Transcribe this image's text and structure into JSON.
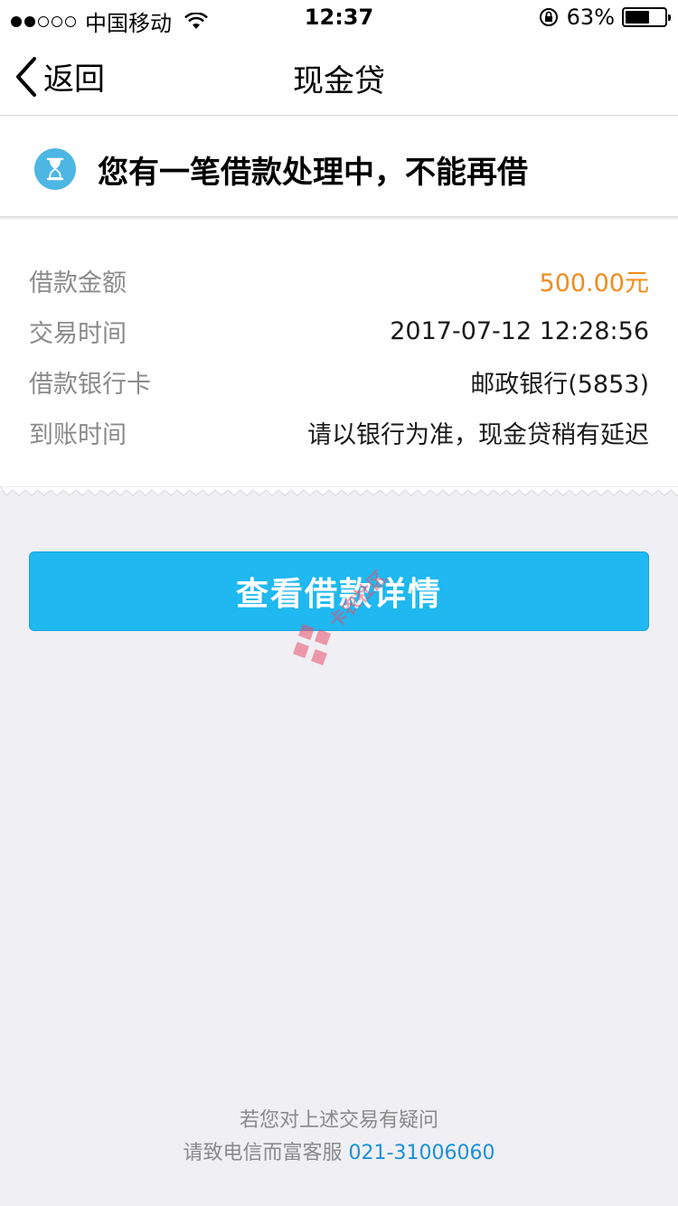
{
  "status_bar": {
    "carrier": "中国移动",
    "time": "12:37",
    "battery": "63%",
    "battery_level": 0.63
  },
  "nav": {
    "back_label": "返回",
    "title": "现金贷"
  },
  "notice": {
    "icon": "hourglass-icon",
    "text": "您有一笔借款处理中，不能再借"
  },
  "details": [
    {
      "label": "借款金额",
      "value": "500.00元"
    },
    {
      "label": "交易时间",
      "value": "2017-07-12 12:28:56"
    },
    {
      "label": "借款银行卡",
      "value": "邮政银行(5853)"
    },
    {
      "label": "到账时间",
      "value": "请以银行为准，现金贷稍有延迟"
    }
  ],
  "actions": {
    "view_details_label": "查看借款详情"
  },
  "watermark": {
    "text": "卡农社区"
  },
  "footer": {
    "line1": "若您对上述交易有疑问",
    "line2_prefix": "请致电信而富客服 ",
    "phone": "021-31006060"
  },
  "colors": {
    "accent": "#1fb8f0",
    "amount": "#f08c1c",
    "link": "#1a90d6",
    "background": "#efeff4"
  }
}
